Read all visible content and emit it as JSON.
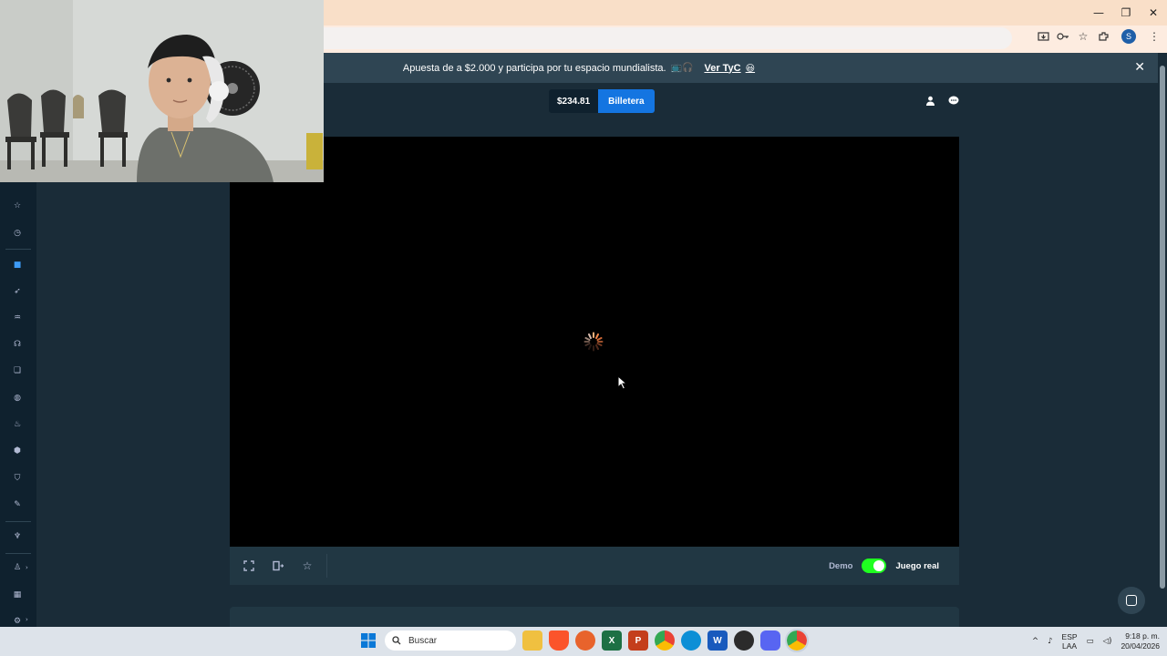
{
  "browser": {
    "window_controls": {
      "minimize": "—",
      "restore": "❐",
      "close": "✕"
    },
    "toolbar_icons": [
      "install-icon",
      "password-key-icon",
      "bookmark-star-icon",
      "extensions-icon"
    ],
    "profile_initial": "S",
    "menu_glyph": "⋮"
  },
  "banner": {
    "text": "Apuesta de a $2.000 y participa por tu espacio mundialista.",
    "emoji": "📺🎧",
    "link": "Ver TyC",
    "link_emoji": "😃",
    "close_glyph": "✕"
  },
  "header": {
    "balance": "$234.81",
    "wallet_label": "Billetera"
  },
  "game_footer": {
    "demo_label": "Demo",
    "real_label": "Juego real",
    "real_mode_on": true
  },
  "taskbar": {
    "search_placeholder": "Buscar",
    "lang_line1": "ESP",
    "lang_line2": "LAA",
    "time": "9:18 p. m.",
    "date": "20/04/2026"
  },
  "colors": {
    "accent": "#1475e1",
    "toggle_on": "#1fff20",
    "page_bg": "#1a2c38",
    "panel_bg": "#213743"
  }
}
